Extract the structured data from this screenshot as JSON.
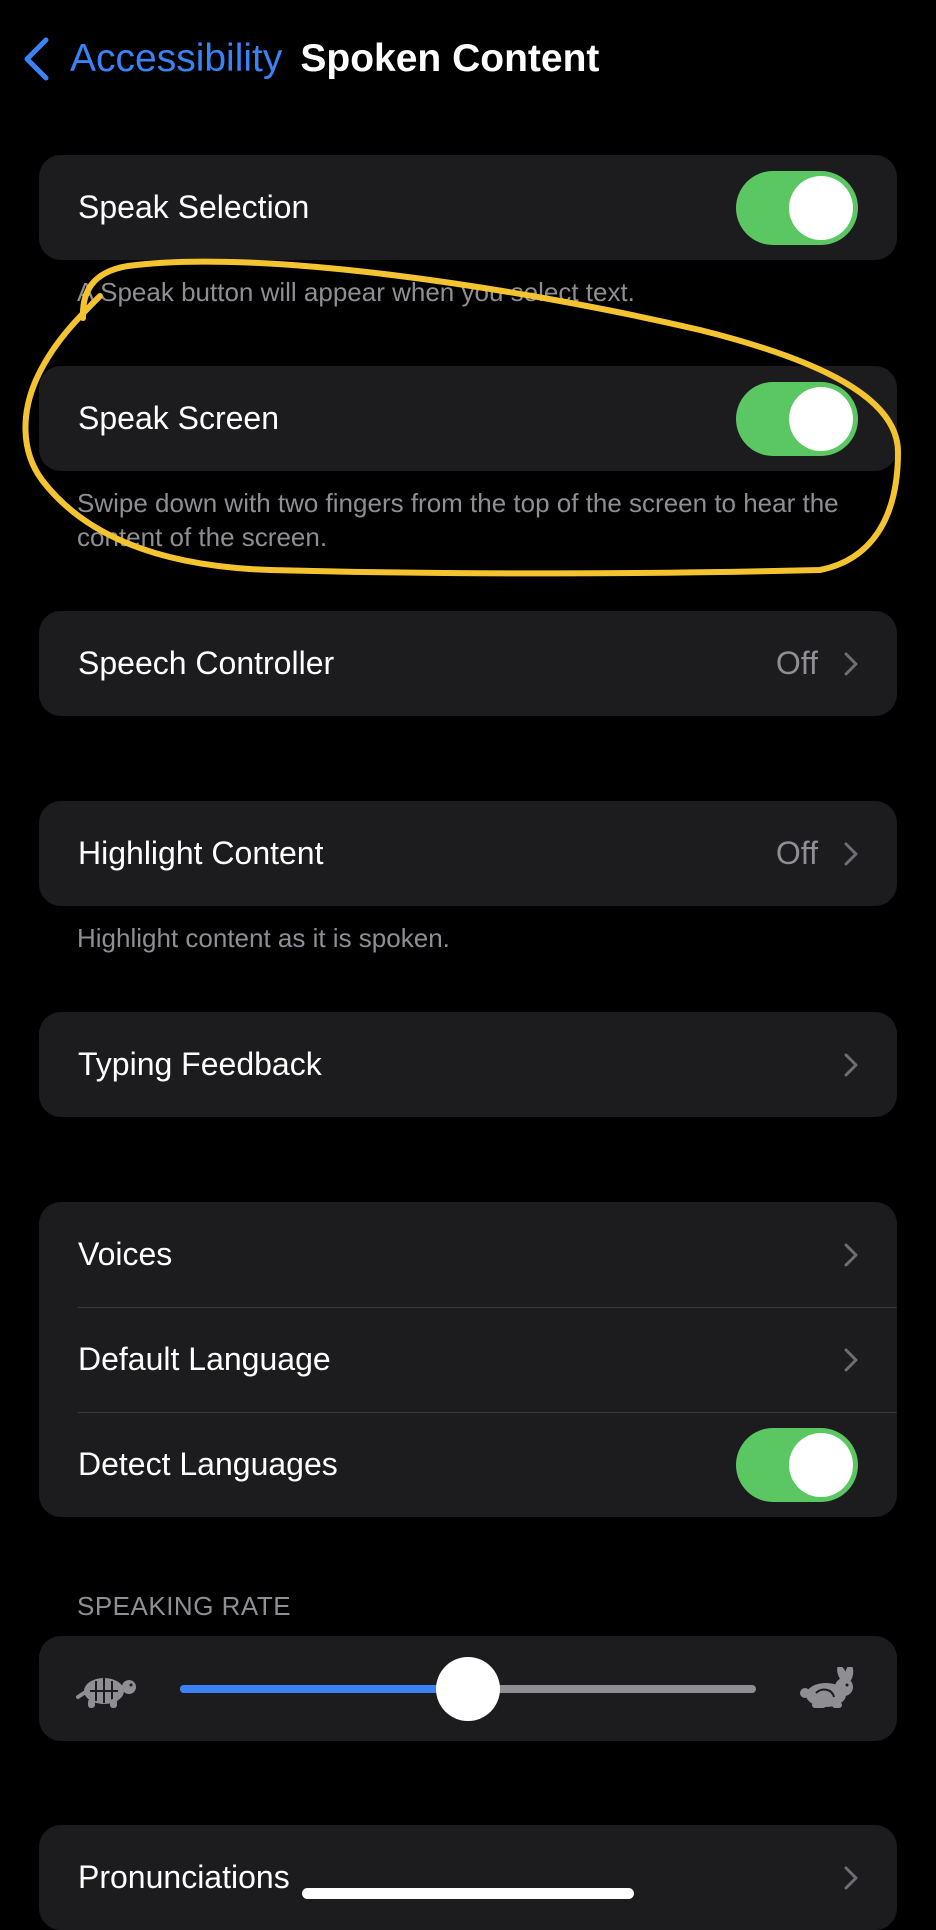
{
  "nav": {
    "back_label": "Accessibility",
    "title": "Spoken Content"
  },
  "speak_selection": {
    "label": "Speak Selection",
    "toggle_on": true,
    "footnote": "A Speak button will appear when you select text."
  },
  "speak_screen": {
    "label": "Speak Screen",
    "toggle_on": true,
    "footnote": "Swipe down with two fingers from the top of the screen to hear the content of the screen."
  },
  "speech_controller": {
    "label": "Speech Controller",
    "value": "Off"
  },
  "highlight_content": {
    "label": "Highlight Content",
    "value": "Off",
    "footnote": "Highlight content as it is spoken."
  },
  "typing_feedback": {
    "label": "Typing Feedback"
  },
  "voice_group": {
    "voices_label": "Voices",
    "default_language_label": "Default Language",
    "detect_languages_label": "Detect Languages",
    "detect_languages_on": true
  },
  "speaking_rate": {
    "header": "SPEAKING RATE",
    "value_percent": 50,
    "slow_icon": "turtle-icon",
    "fast_icon": "rabbit-icon"
  },
  "pronunciations": {
    "label": "Pronunciations"
  },
  "colors": {
    "accent": "#3b82f6",
    "toggle_on": "#5ac763",
    "annotation": "#f4c430"
  }
}
